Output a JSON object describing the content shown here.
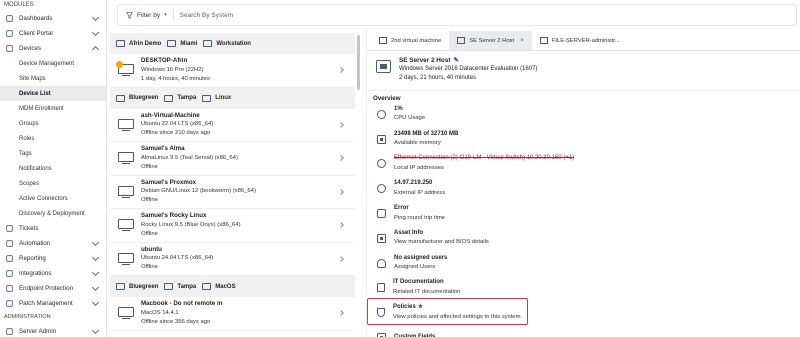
{
  "sidebar": {
    "section_modules": "MODULES",
    "items": [
      {
        "label": "Dashboards",
        "icon": "dashboard-icon",
        "chevron": "down"
      },
      {
        "label": "Client Portal",
        "icon": "portal-icon",
        "chevron": "down"
      },
      {
        "label": "Devices",
        "icon": "devices-icon",
        "chevron": "up"
      }
    ],
    "device_subitems": [
      "Device Management",
      "Site Maps",
      "Device List",
      "MDM Enrollment",
      "Groups",
      "Roles",
      "Tags",
      "Notifications",
      "Scopes",
      "Active Connectors",
      "Discovery & Deployment"
    ],
    "active_subitem": "Device List",
    "items_after": [
      {
        "label": "Tickets",
        "icon": "ticket-icon",
        "chevron": ""
      },
      {
        "label": "Automation",
        "icon": "automation-icon",
        "chevron": "down"
      },
      {
        "label": "Reporting",
        "icon": "reporting-icon",
        "chevron": "down"
      },
      {
        "label": "Integrations",
        "icon": "integrations-icon",
        "chevron": "down"
      },
      {
        "label": "Endpoint Protection",
        "icon": "shield-icon",
        "chevron": "down"
      },
      {
        "label": "Patch Management",
        "icon": "patch-icon",
        "chevron": "down"
      }
    ],
    "section_admin": "ADMINISTRATION",
    "admin_items": [
      {
        "label": "Server Admin",
        "icon": "server-icon",
        "chevron": "down"
      }
    ]
  },
  "filterbar": {
    "filter_label": "Filter by",
    "search_placeholder": "Search By System"
  },
  "device_groups": [
    {
      "tags": [
        "Afrin Demo",
        "Miami",
        "Workstation"
      ],
      "devices": [
        {
          "name": "DESKTOP-Afrin",
          "os": "Windows 10 Pro (22H2)",
          "status": "1 day, 4 hours, 40 minutes",
          "warning": true
        }
      ]
    },
    {
      "tags": [
        "Bluegreen",
        "Tampa",
        "Linux"
      ],
      "devices": [
        {
          "name": "ash-Virtual-Machine",
          "os": "Ubuntu 22.04 LTS (x86_64)",
          "status": "Offline since 210 days ago",
          "warning": false
        },
        {
          "name": "Samuel's Alma",
          "os": "AlmaLinux 9.5 (Teal Serval) (x86_64)",
          "status": "Offline",
          "warning": false
        },
        {
          "name": "Samuel's Proxmox",
          "os": "Debian GNU/Linux 12 (bookworm) (x86_64)",
          "status": "Offline",
          "warning": false
        },
        {
          "name": "Samuel's Rocky Linux",
          "os": "Rocky Linux 9.5 (Blue Onyx) (x86_64)",
          "status": "Offline",
          "warning": false
        },
        {
          "name": "ubuntu",
          "os": "Ubuntu 24.04 LTS (x86_64)",
          "status": "Offline",
          "warning": false
        }
      ]
    },
    {
      "tags": [
        "Bluegreen",
        "Tampa",
        "MacOS"
      ],
      "devices": [
        {
          "name": "Macbook -  Do not remote in",
          "os": "MacOS 14.4.1",
          "status": "Offline since 356 days ago",
          "warning": false
        }
      ]
    }
  ],
  "tabs": [
    {
      "label": "2nd virtual machine",
      "active": false,
      "closable": false
    },
    {
      "label": "SE Server 2 Host",
      "active": true,
      "closable": true
    },
    {
      "label": "FILE-SERVER-administr...",
      "active": false,
      "closable": false
    }
  ],
  "detail": {
    "name": "SE Server 2 Host",
    "os": "Windows Server 2016 Datacenter Evaluation (1607)",
    "uptime": "2 days, 21 hours, 40 minutes",
    "overview_title": "Overview",
    "items": [
      {
        "value": "1%",
        "desc": "CPU Usage",
        "icon": "cpu-icon",
        "shape": "circle"
      },
      {
        "value": "23498 MB of 32710 MB",
        "desc": "Available memory",
        "icon": "memory-icon",
        "shape": "sq"
      },
      {
        "value": "Ethernet Connection (2) I219-LM - Virtual Switch) 10.20.30.150 (+1)",
        "desc": "Local IP addresses",
        "icon": "network-icon",
        "shape": "net",
        "redacted": true
      },
      {
        "value": "14.97.219.250",
        "desc": "External IP address",
        "icon": "globe-icon",
        "shape": "net"
      },
      {
        "value": "Error",
        "desc": "Ping round trip time",
        "icon": "ping-icon",
        "shape": "arr"
      },
      {
        "value": "Asset Info",
        "desc": "View manufacturer and BIOS details",
        "icon": "asset-icon",
        "shape": "sq"
      },
      {
        "value": "No assigned users",
        "desc": "Assigned Users",
        "icon": "user-icon",
        "shape": "user"
      },
      {
        "value": "IT Documentation",
        "desc": "Related IT documentation",
        "icon": "document-icon",
        "shape": "doc"
      },
      {
        "value": "Policies",
        "desc": "View policies and affected settings to this system",
        "icon": "shield-icon",
        "shape": "shield",
        "starred": true
      },
      {
        "value": "Custom Fields",
        "desc": "",
        "icon": "fields-icon",
        "shape": "sq"
      }
    ]
  },
  "colors": {
    "accent": "#3550a0",
    "highlight_border": "#d13d3d",
    "warning": "#f2a900",
    "group_header_bg": "#f1f1f1",
    "active_bg": "#e8eaee"
  }
}
